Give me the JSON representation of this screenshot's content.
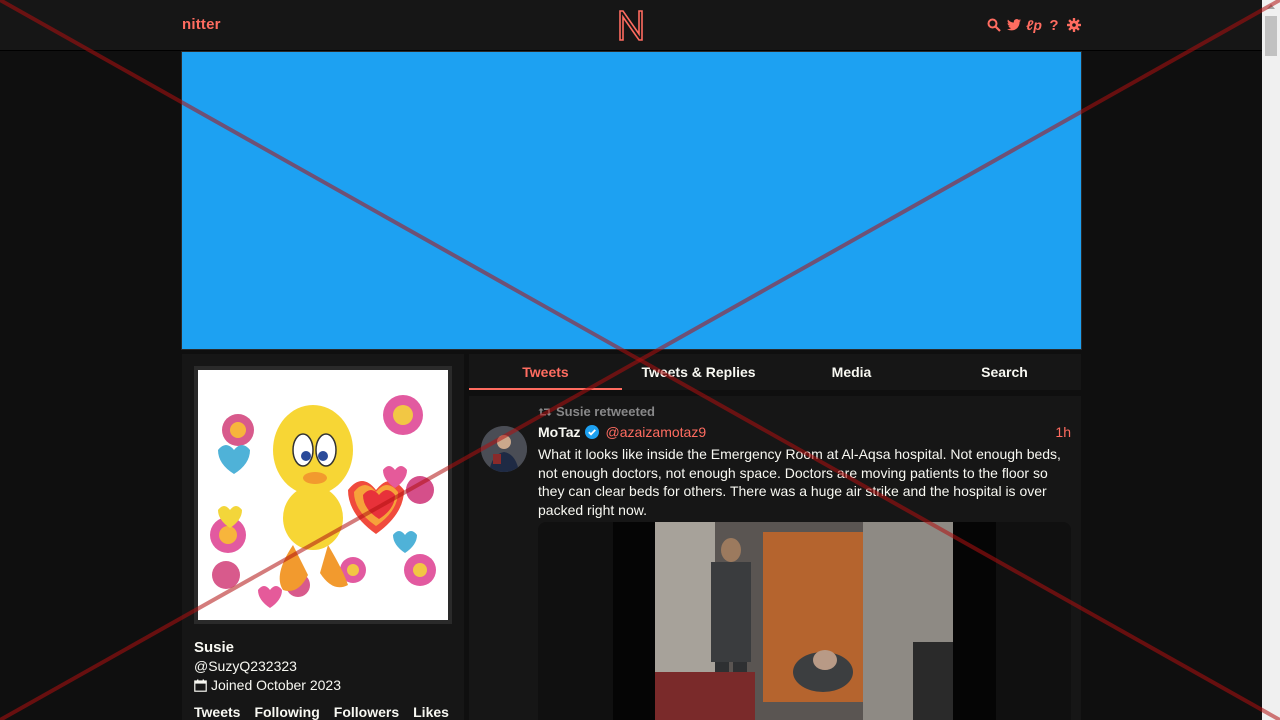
{
  "navbar": {
    "brand": "nitter",
    "logo_letter": "N",
    "icons": [
      "search-icon",
      "twitter-bird-icon",
      "lp-icon",
      "help-icon",
      "gear-icon"
    ],
    "lp_label": "ℓp",
    "help_label": "?"
  },
  "colors": {
    "accent": "#ff6c60",
    "banner": "#1da1f2",
    "background": "#0f0f0f",
    "panel": "#161616",
    "text": "#f8f8f2",
    "muted": "#888889",
    "verified": "#1da1f2"
  },
  "profile": {
    "fullname": "Susie",
    "username": "@SuzyQ232323",
    "joined": "Joined October 2023",
    "stats": [
      "Tweets",
      "Following",
      "Followers",
      "Likes"
    ]
  },
  "tabs": [
    {
      "label": "Tweets",
      "active": true
    },
    {
      "label": "Tweets & Replies",
      "active": false
    },
    {
      "label": "Media",
      "active": false
    },
    {
      "label": "Search",
      "active": false
    }
  ],
  "tweet": {
    "retweet_header": "Susie retweeted",
    "fullname": "MoTaz",
    "username": "@azaizamotaz9",
    "date": "1h",
    "text": "What it looks like inside the Emergency Room at Al-Aqsa hospital. Not enough beds, not enough doctors, not enough space. Doctors are moving patients to the floor so they can clear beds for others. There was a huge air strike and the hospital is over packed right now."
  }
}
